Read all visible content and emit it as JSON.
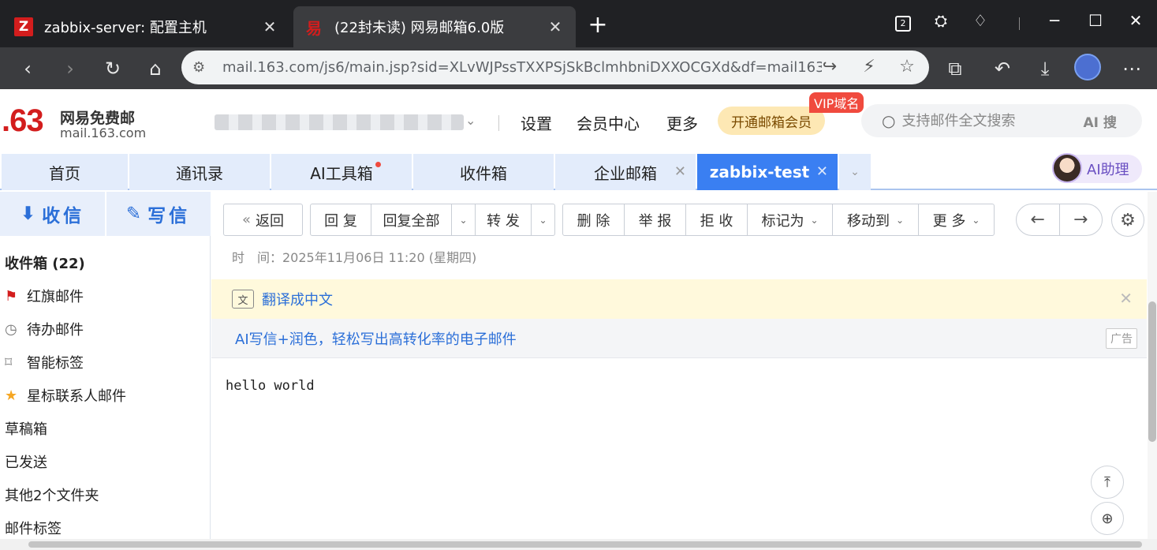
{
  "browser": {
    "tabs": [
      {
        "title": "zabbix-server: 配置主机",
        "favicon": "Z"
      },
      {
        "title": "(22封未读) 网易邮箱6.0版",
        "favicon": "易"
      }
    ],
    "new_tab": "+",
    "tab_count": "2",
    "url": "mail.163.com/js6/main.jsp?sid=XLvWJPssTXXPSjSkBclmhbniDXXOCGXd&df=mail163...",
    "colors": {
      "titlebar": "#202124",
      "toolbar": "#3b3c3f"
    }
  },
  "mail": {
    "logo": {
      "mark": ".63",
      "name": "网易免费邮",
      "domain": "mail.163.com"
    },
    "header_links": [
      "设置",
      "会员中心",
      "更多"
    ],
    "vip_button": "开通邮箱会员",
    "vip_badge": "VIP域名",
    "search": {
      "placeholder": "支持邮件全文搜索",
      "ai_label": "AI 搜"
    },
    "tabs": [
      {
        "label": "首页"
      },
      {
        "label": "通讯录"
      },
      {
        "label": "AI工具箱"
      },
      {
        "label": "收件箱"
      },
      {
        "label": "企业邮箱"
      },
      {
        "label": "zabbix-test"
      }
    ],
    "ai_assistant": "AI助理",
    "sidebar": {
      "receive": "收信",
      "compose": "写信",
      "items": [
        {
          "label": "收件箱 (22)"
        },
        {
          "label": "红旗邮件"
        },
        {
          "label": "待办邮件"
        },
        {
          "label": "智能标签"
        },
        {
          "label": "星标联系人邮件"
        },
        {
          "label": "草稿箱"
        },
        {
          "label": "已发送"
        },
        {
          "label": "其他2个文件夹"
        },
        {
          "label": "邮件标签"
        }
      ]
    },
    "toolbar": {
      "back": "返回",
      "reply": "回 复",
      "reply_all": "回复全部",
      "forward": "转 发",
      "delete": "删 除",
      "report": "举 报",
      "reject": "拒 收",
      "mark_as": "标记为",
      "move_to": "移动到",
      "more": "更 多"
    },
    "message": {
      "time": "时　间：2025年11月06日 11:20 (星期四)",
      "translate": "翻译成中文",
      "ad_text": "AI写信+润色，轻松写出高转化率的电子邮件",
      "ad_tag": "广告",
      "body": "hello world"
    },
    "colors": {
      "accent": "#3a7ff2",
      "brand_red": "#d31d1d",
      "link": "#2b6fd8"
    }
  }
}
